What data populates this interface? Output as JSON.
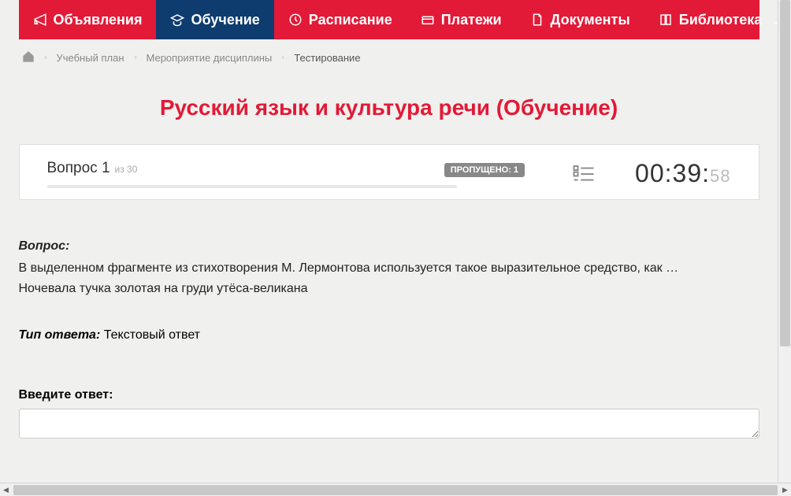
{
  "nav": {
    "items": [
      {
        "label": "Объявления",
        "icon": "megaphone"
      },
      {
        "label": "Обучение",
        "icon": "graduation-cap"
      },
      {
        "label": "Расписание",
        "icon": "clock"
      },
      {
        "label": "Платежи",
        "icon": "payment"
      },
      {
        "label": "Документы",
        "icon": "document"
      },
      {
        "label": "Библиотека",
        "icon": "book"
      }
    ]
  },
  "breadcrumb": {
    "items": [
      {
        "label": "Учебный план"
      },
      {
        "label": "Мероприятие дисциплины"
      },
      {
        "label": "Тестирование"
      }
    ]
  },
  "page_title": "Русский язык и культура речи (Обучение)",
  "status": {
    "question_label": "Вопрос 1",
    "of_total": "из 30",
    "skipped_label": "ПРОПУЩЕНО: 1",
    "timer_main": "00:39:",
    "timer_sec": "58"
  },
  "question": {
    "label": "Вопрос:",
    "line1": "В выделенном фрагменте из стихотворения М. Лермонтова используется такое выразительное средство, как …",
    "line2": "Ночевала тучка золотая на груди утёса-великана"
  },
  "answer_type": {
    "label": "Тип ответа:",
    "value": "Текстовый ответ"
  },
  "answer_input": {
    "label": "Введите ответ:",
    "value": ""
  }
}
